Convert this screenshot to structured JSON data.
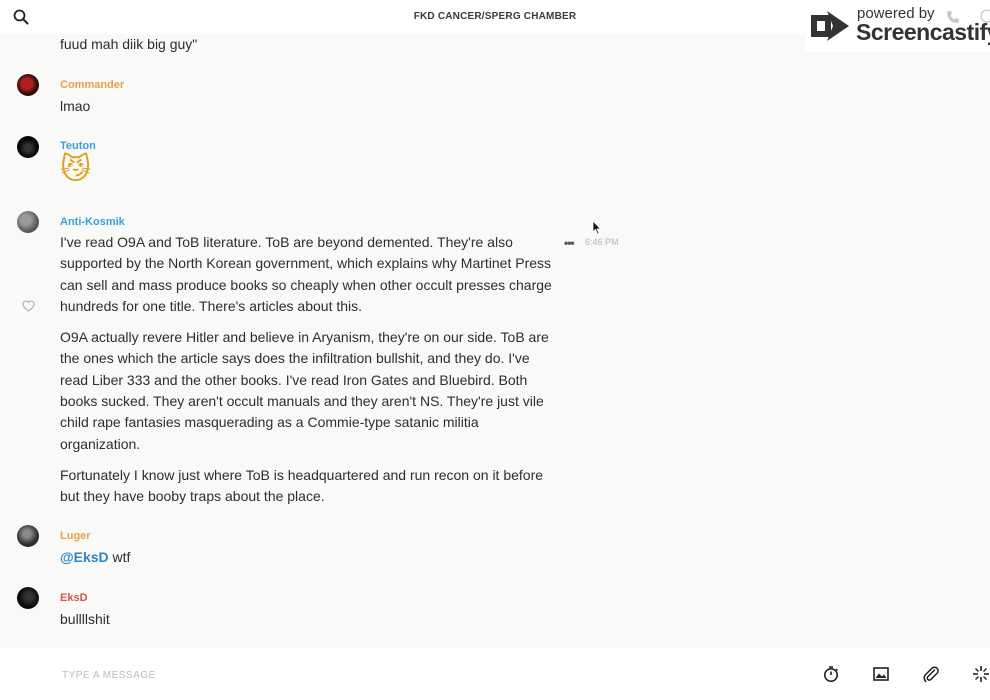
{
  "header": {
    "channel_title": "FKD CANCER/SPERG CHAMBER"
  },
  "watermark": {
    "line1": "powered by",
    "line2": "Screencastify"
  },
  "partial_message": "fuud mah diik big guy\"",
  "messages": [
    {
      "author": "Commander",
      "author_color": "#e8a04b",
      "text": "lmao"
    },
    {
      "author": "Teuton",
      "author_color": "#3aa0d8",
      "emoji": "😼"
    },
    {
      "author": "Anti-Kosmik",
      "author_color": "#3aa0d8",
      "timestamp": "6:46 PM",
      "paragraphs": [
        "I've read O9A and ToB literature. ToB are beyond demented. They're also supported by the North Korean government, which explains why Martinet Press can sell and mass produce books so cheaply when other occult presses charge hundreds for one title. There's articles about this.",
        "O9A actually revere Hitler and believe in Aryanism, they're on our side. ToB are the ones which the article says does the infiltration bullshit, and they do. I've read Liber 333 and the other books. I've read Iron Gates and Bluebird. Both books sucked. They aren't occult manuals and they aren't NS. They're just vile child rape fantasies masquerading as a Commie-type satanic militia organization.",
        "Fortunately I know just where ToB is headquartered and run recon on it before but they have booby traps about the place."
      ]
    },
    {
      "author": "Luger",
      "author_color": "#e8a04b",
      "mention": "@EksD",
      "text": " wtf"
    },
    {
      "author": "EksD",
      "author_color": "#d9534f",
      "text": "bullllshit"
    }
  ],
  "composer": {
    "placeholder": "TYPE A MESSAGE"
  },
  "icons": {
    "search": "search-icon",
    "timer": "timer-icon",
    "image": "image-icon",
    "attach": "paperclip-icon",
    "more": "sparkle-icon"
  }
}
